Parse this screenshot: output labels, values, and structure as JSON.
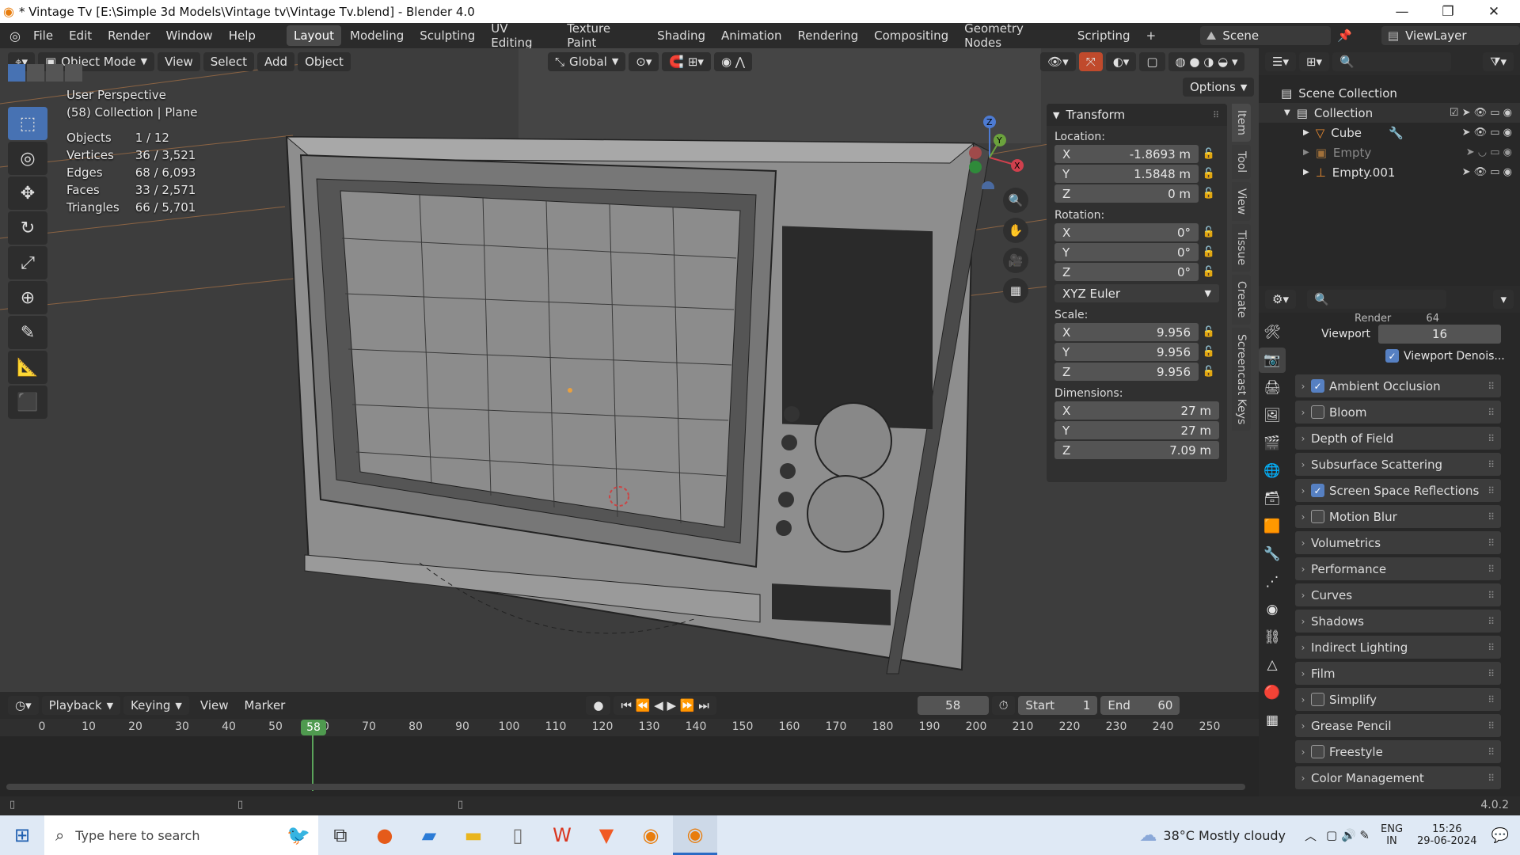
{
  "window": {
    "title": "* Vintage Tv [E:\\Simple 3d Models\\Vintage tv\\Vintage Tv.blend] - Blender 4.0"
  },
  "menus": [
    "File",
    "Edit",
    "Render",
    "Window",
    "Help"
  ],
  "workspaces": [
    "Layout",
    "Modeling",
    "Sculpting",
    "UV Editing",
    "Texture Paint",
    "Shading",
    "Animation",
    "Rendering",
    "Compositing",
    "Geometry Nodes",
    "Scripting"
  ],
  "active_workspace": "Layout",
  "scene": "Scene",
  "view_layer": "ViewLayer",
  "viewport_header": {
    "mode": "Object Mode",
    "view": "View",
    "select": "Select",
    "add": "Add",
    "object": "Object",
    "orientation": "Global",
    "options": "Options"
  },
  "viewport_info": {
    "perspective": "User Perspective",
    "collection": "(58) Collection | Plane",
    "stats": [
      {
        "label": "Objects",
        "value": "1 / 12"
      },
      {
        "label": "Vertices",
        "value": "36 / 3,521"
      },
      {
        "label": "Edges",
        "value": "68 / 6,093"
      },
      {
        "label": "Faces",
        "value": "33 / 2,571"
      },
      {
        "label": "Triangles",
        "value": "66 / 5,701"
      }
    ]
  },
  "transform": {
    "title": "Transform",
    "location_label": "Location:",
    "location": [
      {
        "axis": "X",
        "value": "-1.8693 m"
      },
      {
        "axis": "Y",
        "value": "1.5848 m"
      },
      {
        "axis": "Z",
        "value": "0 m"
      }
    ],
    "rotation_label": "Rotation:",
    "rotation": [
      {
        "axis": "X",
        "value": "0°"
      },
      {
        "axis": "Y",
        "value": "0°"
      },
      {
        "axis": "Z",
        "value": "0°"
      }
    ],
    "rotation_mode": "XYZ Euler",
    "scale_label": "Scale:",
    "scale": [
      {
        "axis": "X",
        "value": "9.956"
      },
      {
        "axis": "Y",
        "value": "9.956"
      },
      {
        "axis": "Z",
        "value": "9.956"
      }
    ],
    "dimensions_label": "Dimensions:",
    "dimensions": [
      {
        "axis": "X",
        "value": "27 m"
      },
      {
        "axis": "Y",
        "value": "27 m"
      },
      {
        "axis": "Z",
        "value": "7.09 m"
      }
    ]
  },
  "sidebar_tabs": [
    "Item",
    "Tool",
    "View",
    "Tissue",
    "Create",
    "Screencast Keys"
  ],
  "outliner": {
    "root": "Scene Collection",
    "collection": "Collection",
    "items": [
      "Cube",
      "Empty",
      "Empty.001"
    ]
  },
  "properties": {
    "partial_label": "Render",
    "partial_value": "64",
    "viewport_label": "Viewport",
    "viewport_value": "16",
    "denoise_label": "Viewport Denois...",
    "panels": [
      {
        "label": "Ambient Occlusion",
        "checkbox": true,
        "checked": true
      },
      {
        "label": "Bloom",
        "checkbox": true,
        "checked": false
      },
      {
        "label": "Depth of Field",
        "checkbox": false,
        "checked": false
      },
      {
        "label": "Subsurface Scattering",
        "checkbox": false,
        "checked": false
      },
      {
        "label": "Screen Space Reflections",
        "checkbox": true,
        "checked": true
      },
      {
        "label": "Motion Blur",
        "checkbox": true,
        "checked": false
      },
      {
        "label": "Volumetrics",
        "checkbox": false,
        "checked": false
      },
      {
        "label": "Performance",
        "checkbox": false,
        "checked": false
      },
      {
        "label": "Curves",
        "checkbox": false,
        "checked": false
      },
      {
        "label": "Shadows",
        "checkbox": false,
        "checked": false
      },
      {
        "label": "Indirect Lighting",
        "checkbox": false,
        "checked": false
      },
      {
        "label": "Film",
        "checkbox": false,
        "checked": false
      },
      {
        "label": "Simplify",
        "checkbox": true,
        "checked": false
      },
      {
        "label": "Grease Pencil",
        "checkbox": false,
        "checked": false
      },
      {
        "label": "Freestyle",
        "checkbox": true,
        "checked": false
      },
      {
        "label": "Color Management",
        "checkbox": false,
        "checked": false
      }
    ]
  },
  "timeline": {
    "playback": "Playback",
    "keying": "Keying",
    "view": "View",
    "marker": "Marker",
    "current_frame": "58",
    "start_label": "Start",
    "start": "1",
    "end_label": "End",
    "end": "60",
    "ticks": [
      "0",
      "10",
      "20",
      "30",
      "40",
      "50",
      "60",
      "70",
      "80",
      "90",
      "100",
      "110",
      "120",
      "130",
      "140",
      "150",
      "160",
      "170",
      "180",
      "190",
      "200",
      "210",
      "220",
      "230",
      "240",
      "250"
    ]
  },
  "statusbar": {
    "version": "4.0.2"
  },
  "taskbar": {
    "search_placeholder": "Type here to search",
    "weather": "38°C Mostly cloudy",
    "lang1": "ENG",
    "lang2": "IN",
    "time": "15:26",
    "date": "29-06-2024"
  }
}
